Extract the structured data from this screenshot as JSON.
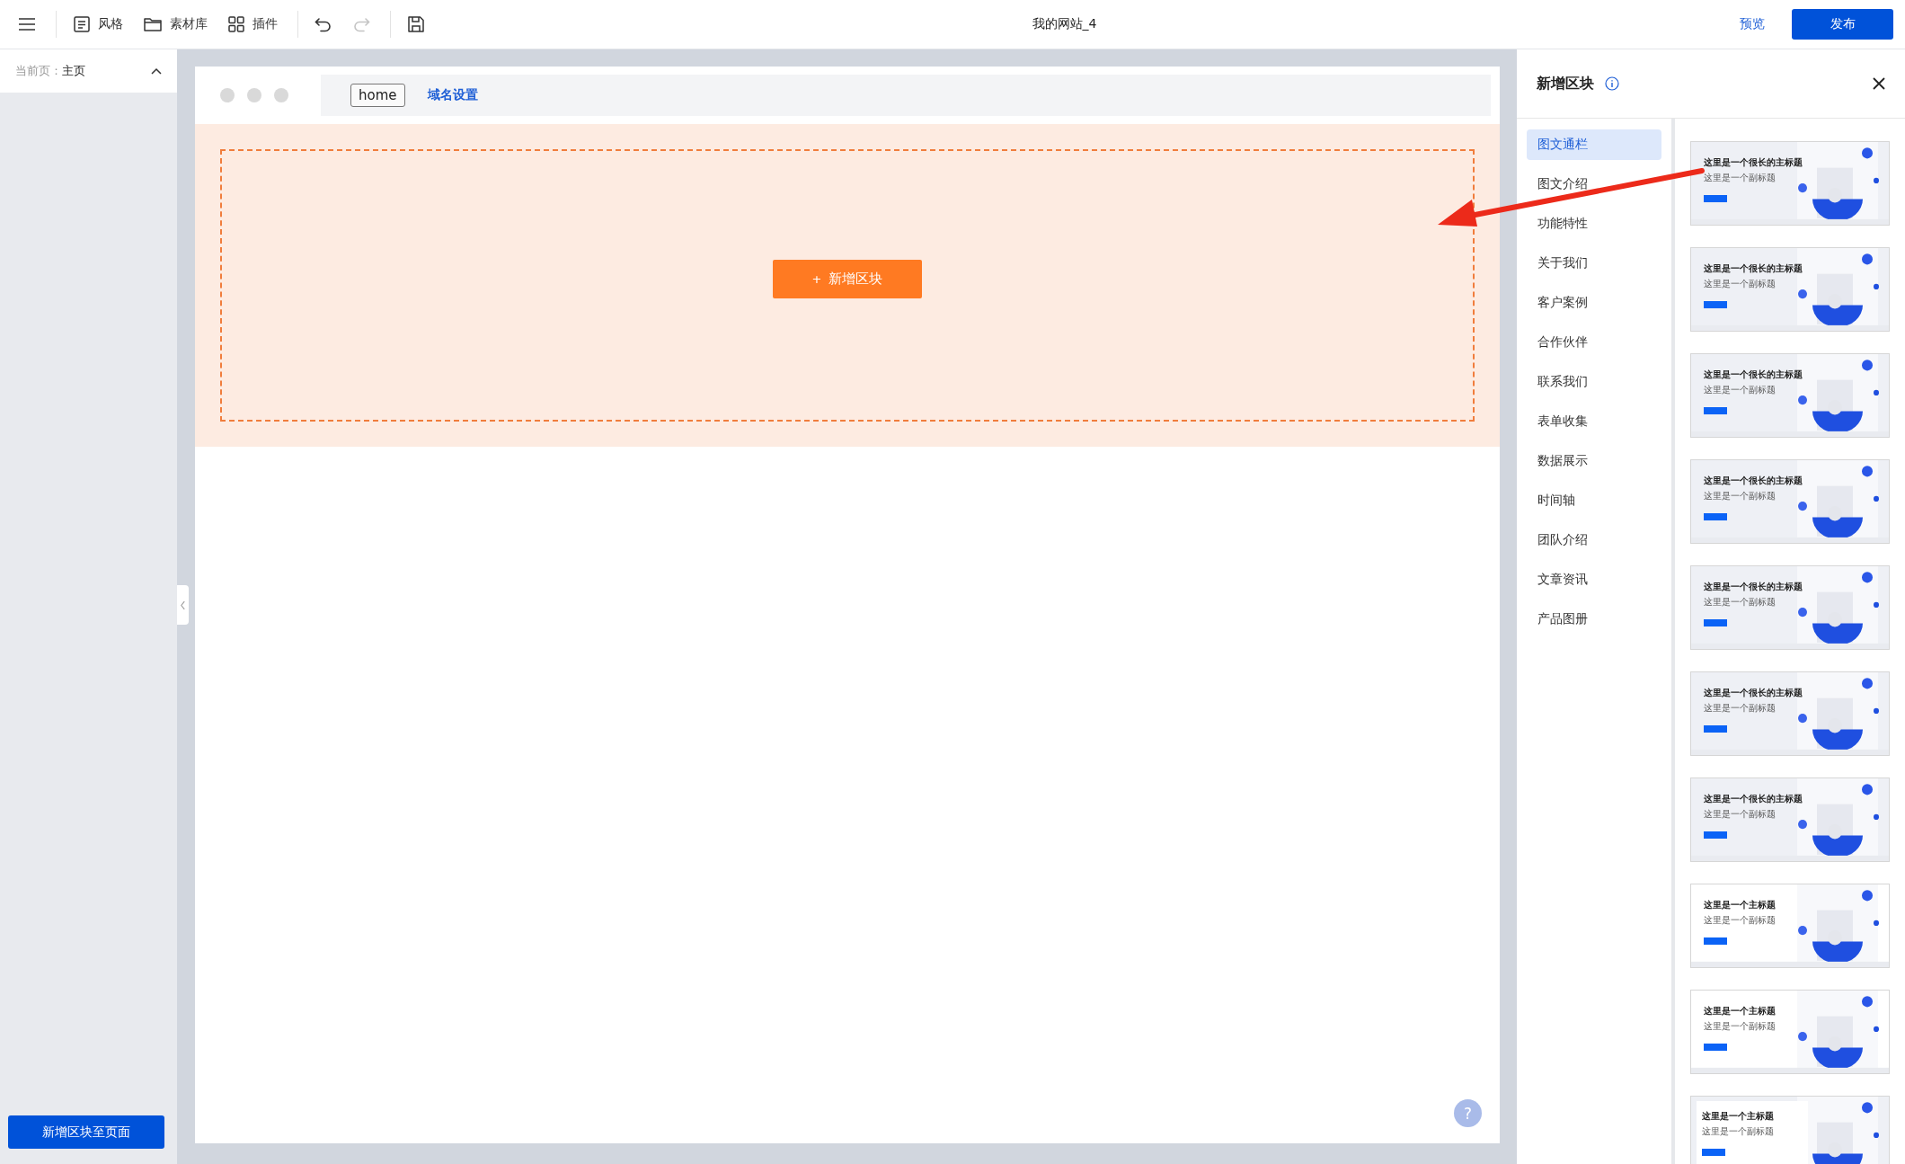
{
  "toolbar": {
    "tools": [
      {
        "kind": "style",
        "label": "风格"
      },
      {
        "kind": "assets",
        "label": "素材库"
      },
      {
        "kind": "plugins",
        "label": "插件"
      }
    ],
    "history": [
      {
        "kind": "undo",
        "disabled": false
      },
      {
        "kind": "redo",
        "disabled": true
      }
    ],
    "title": "我的网站_4",
    "preview": "预览",
    "publish": "发布"
  },
  "page_panel": {
    "label": "当前页：",
    "page": "主页",
    "expanded": true,
    "add_button": "新增区块至页面"
  },
  "canvas": {
    "address_tab": "home",
    "domain_link": "域名设置",
    "add_block_button": {
      "icon": "+",
      "label": "新增区块"
    },
    "help_button": "?"
  },
  "block_panel": {
    "title": "新增区块",
    "categories": [
      {
        "label": "图文通栏",
        "selected": true
      },
      {
        "label": "图文介绍",
        "selected": false
      },
      {
        "label": "功能特性",
        "selected": false
      },
      {
        "label": "关于我们",
        "selected": false
      },
      {
        "label": "客户案例",
        "selected": false
      },
      {
        "label": "合作伙伴",
        "selected": false
      },
      {
        "label": "联系我们",
        "selected": false
      },
      {
        "label": "表单收集",
        "selected": false
      },
      {
        "label": "数据展示",
        "selected": false
      },
      {
        "label": "时间轴",
        "selected": false
      },
      {
        "label": "团队介绍",
        "selected": false
      },
      {
        "label": "文章资讯",
        "selected": false
      },
      {
        "label": "产品图册",
        "selected": false
      }
    ],
    "templates": [
      {
        "kind": "wide",
        "title": "这里是一个很长的主标题",
        "subtitle": "这里是一个副标题"
      },
      {
        "kind": "wide",
        "title": "这里是一个很长的主标题",
        "subtitle": "这里是一个副标题"
      },
      {
        "kind": "wide",
        "title": "这里是一个很长的主标题",
        "subtitle": "这里是一个副标题"
      },
      {
        "kind": "wide",
        "title": "这里是一个很长的主标题",
        "subtitle": "这里是一个副标题"
      },
      {
        "kind": "wide",
        "title": "这里是一个很长的主标题",
        "subtitle": "这里是一个副标题"
      },
      {
        "kind": "wide",
        "title": "这里是一个很长的主标题",
        "subtitle": "这里是一个副标题"
      },
      {
        "kind": "wide",
        "title": "这里是一个很长的主标题",
        "subtitle": "这里是一个副标题"
      },
      {
        "kind": "split",
        "title": "这里是一个主标题",
        "subtitle": "这里是一个副标题"
      },
      {
        "kind": "split",
        "title": "这里是一个主标题",
        "subtitle": "这里是一个副标题"
      },
      {
        "kind": "card",
        "title": "这里是一个主标题",
        "subtitle": "这里是一个副标题"
      }
    ]
  }
}
